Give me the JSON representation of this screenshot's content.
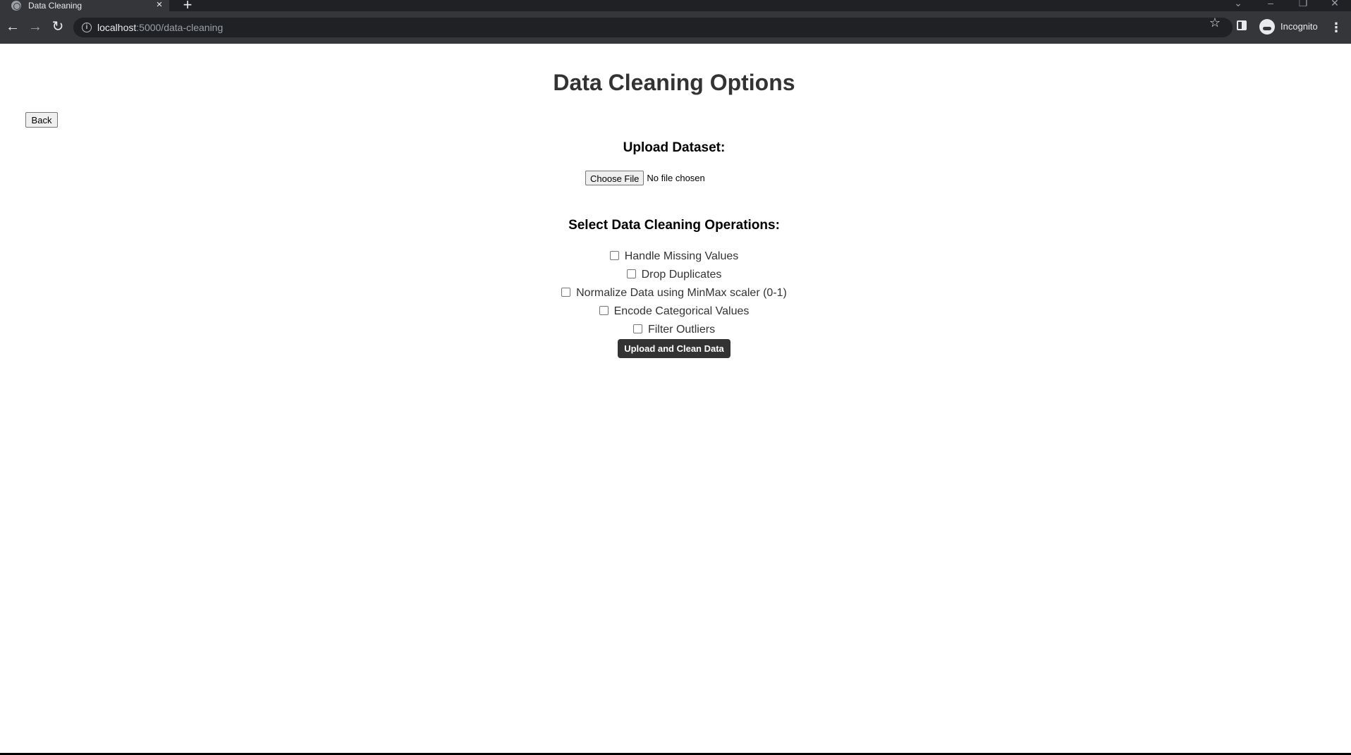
{
  "browser": {
    "tab_title": "Data Cleaning",
    "tab_close": "×",
    "new_tab": "+",
    "url_host": "localhost",
    "url_path": ":5000/data-cleaning",
    "profile_label": "Incognito",
    "icons": {
      "back": "←",
      "forward": "→",
      "reload": "↻",
      "info": "i",
      "star": "☆",
      "menu": "⋮",
      "tab_search": "⌄",
      "minimize": "–",
      "restore": "❐",
      "close": "✕"
    }
  },
  "page": {
    "title": "Data Cleaning Options",
    "back_label": "Back",
    "upload_heading": "Upload Dataset:",
    "choose_file_label": "Choose File",
    "file_status": "No file chosen",
    "operations_heading": "Select Data Cleaning Operations:",
    "operations": [
      {
        "label": "Handle Missing Values",
        "checked": false
      },
      {
        "label": "Drop Duplicates",
        "checked": false
      },
      {
        "label": "Normalize Data using MinMax scaler (0-1)",
        "checked": false
      },
      {
        "label": "Encode Categorical Values",
        "checked": false
      },
      {
        "label": "Filter Outliers",
        "checked": false
      }
    ],
    "submit_label": "Upload and Clean Data"
  },
  "colors": {
    "chrome_dark": "#202124",
    "chrome_toolbar": "#35363a",
    "page_background": "#ffffff",
    "heading_text": "#333333",
    "primary_button": "#333333"
  }
}
